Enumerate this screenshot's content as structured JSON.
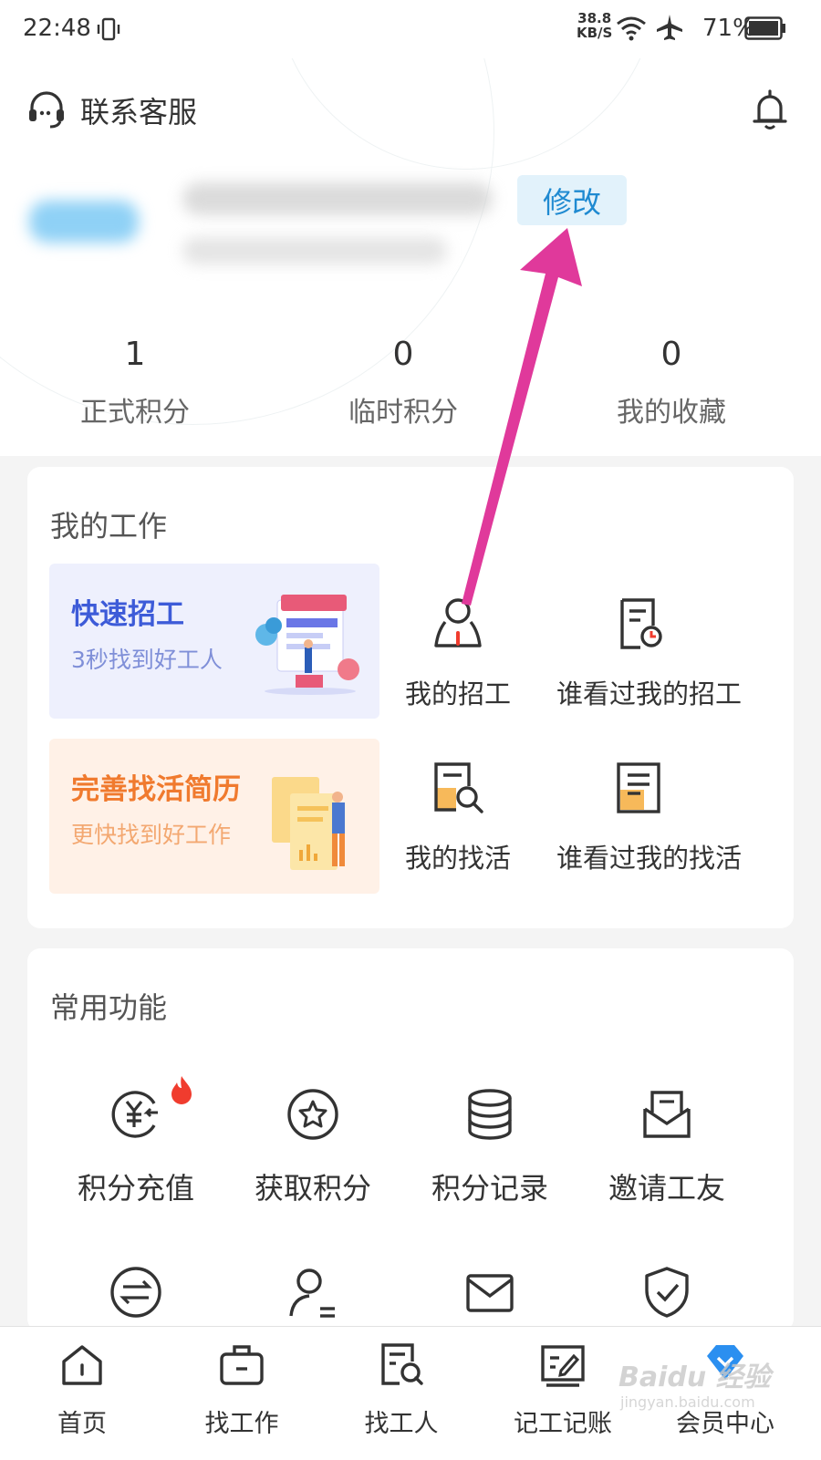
{
  "status_bar": {
    "time": "22:48",
    "net_speed": "38.8",
    "net_unit": "KB/S",
    "battery": "71%"
  },
  "header": {
    "service_label": "联系客服",
    "edit_label": "修改"
  },
  "stats": [
    {
      "value": "1",
      "label": "正式积分"
    },
    {
      "value": "0",
      "label": "临时积分"
    },
    {
      "value": "0",
      "label": "我的收藏"
    }
  ],
  "my_work": {
    "title": "我的工作",
    "promo_recruit": {
      "title": "快速招工",
      "subtitle": "3秒找到好工人"
    },
    "promo_resume": {
      "title": "完善找活简历",
      "subtitle": "更快找到好工作"
    },
    "items": [
      {
        "label": "我的招工",
        "icon": "worker-icon"
      },
      {
        "label": "谁看过我的招工",
        "icon": "doc-view-icon"
      },
      {
        "label": "我的找活",
        "icon": "doc-search-icon"
      },
      {
        "label": "谁看过我的找活",
        "icon": "doc-list-icon"
      }
    ]
  },
  "common_functions": {
    "title": "常用功能",
    "items": [
      {
        "label": "积分充值",
        "icon": "yuan-recharge-icon"
      },
      {
        "label": "获取积分",
        "icon": "star-icon"
      },
      {
        "label": "积分记录",
        "icon": "database-icon"
      },
      {
        "label": "邀请工友",
        "icon": "mail-open-icon"
      },
      {
        "label": "",
        "icon": "exchange-icon"
      },
      {
        "label": "",
        "icon": "user-minus-icon"
      },
      {
        "label": "",
        "icon": "mail-icon"
      },
      {
        "label": "",
        "icon": "shield-check-icon"
      }
    ]
  },
  "bottom_nav": [
    {
      "label": "首页",
      "icon": "home-icon"
    },
    {
      "label": "找工作",
      "icon": "briefcase-icon"
    },
    {
      "label": "找工人",
      "icon": "worker-search-icon"
    },
    {
      "label": "记工记账",
      "icon": "ledger-icon"
    },
    {
      "label": "会员中心",
      "icon": "member-icon"
    }
  ],
  "watermark": {
    "text": "Baidu 经验",
    "sub": "jingyan.baidu.com"
  },
  "colors": {
    "accent_blue": "#1f8ad1",
    "edit_bg": "#e2f2fb",
    "arrow_pink": "#e0399b",
    "recruit_title": "#3d5bd8",
    "resume_title": "#f07a2e",
    "fire_red": "#f03c2e"
  }
}
